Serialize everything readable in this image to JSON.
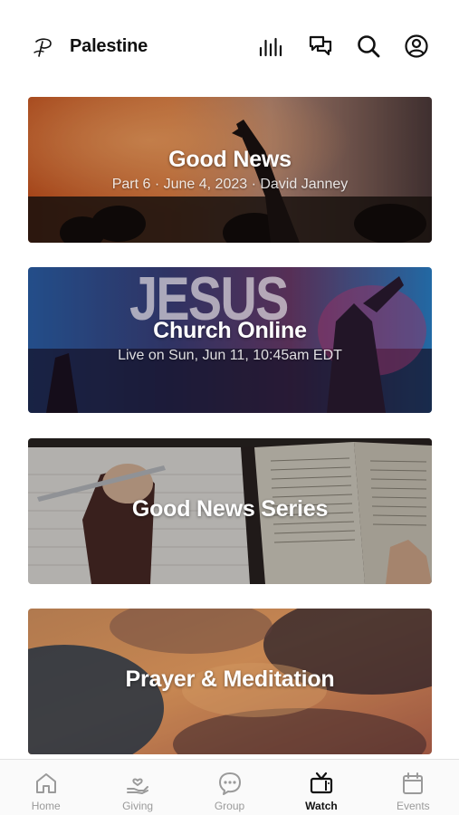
{
  "header": {
    "app_title": "Palestine",
    "icons": [
      "logo-icon",
      "bar-chart-icon",
      "chat-icon",
      "search-icon",
      "profile-icon"
    ]
  },
  "cards": [
    {
      "title": "Good News",
      "subtitle": "Part 6 · June 4, 2023 · David Janney"
    },
    {
      "title": "Church Online",
      "subtitle": "Live on Sun, Jun 11, 10:45am EDT",
      "image_text": "JESUS"
    },
    {
      "title": "Good News Series"
    },
    {
      "title": "Prayer & Meditation"
    }
  ],
  "tabs": [
    {
      "label": "Home",
      "icon": "home-icon",
      "active": false
    },
    {
      "label": "Giving",
      "icon": "giving-icon",
      "active": false
    },
    {
      "label": "Group",
      "icon": "group-icon",
      "active": false
    },
    {
      "label": "Watch",
      "icon": "tv-icon",
      "active": true
    },
    {
      "label": "Events",
      "icon": "calendar-icon",
      "active": false
    }
  ],
  "colors": {
    "active_tab": "#111111",
    "inactive_tab": "#9a9a9a",
    "background": "#ffffff"
  }
}
